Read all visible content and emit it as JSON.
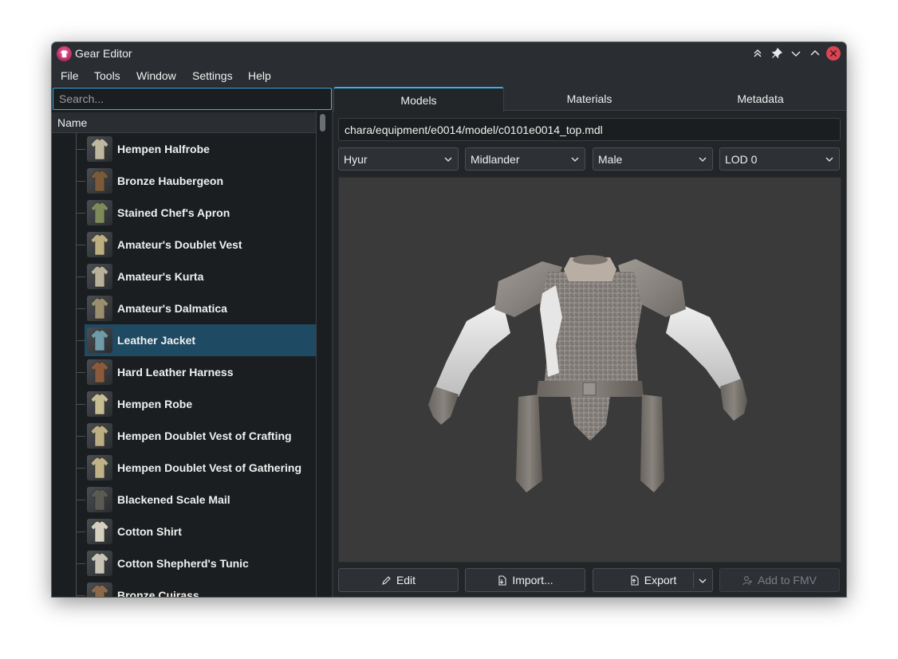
{
  "window": {
    "title": "Gear Editor"
  },
  "titlebar_buttons": [
    "keep-above-icon",
    "pin-icon",
    "minimize-icon",
    "maximize-icon",
    "close-icon"
  ],
  "menu": [
    "File",
    "Tools",
    "Window",
    "Settings",
    "Help"
  ],
  "sidebar": {
    "search_placeholder": "Search...",
    "header": "Name",
    "items": [
      {
        "label": "Hempen Halfrobe",
        "color": "#bfb7a0"
      },
      {
        "label": "Bronze Haubergeon",
        "color": "#7a5a3a"
      },
      {
        "label": "Stained Chef's Apron",
        "color": "#7e8a5a"
      },
      {
        "label": "Amateur's Doublet Vest",
        "color": "#bcae80"
      },
      {
        "label": "Amateur's Kurta",
        "color": "#b8b09a"
      },
      {
        "label": "Amateur's Dalmatica",
        "color": "#9a8e6e"
      },
      {
        "label": "Leather Jacket",
        "color": "#6f9aa8"
      },
      {
        "label": "Hard Leather Harness",
        "color": "#8a5a3a"
      },
      {
        "label": "Hempen Robe",
        "color": "#c8bd92"
      },
      {
        "label": "Hempen Doublet Vest of Crafting",
        "color": "#bcae80"
      },
      {
        "label": "Hempen Doublet Vest of Gathering",
        "color": "#c0b286"
      },
      {
        "label": "Blackened Scale Mail",
        "color": "#5a5a52"
      },
      {
        "label": "Cotton Shirt",
        "color": "#d6d0c0"
      },
      {
        "label": "Cotton Shepherd's Tunic",
        "color": "#c8c4b6"
      },
      {
        "label": "Bronze Cuirass",
        "color": "#8a6a4a"
      }
    ],
    "selected_index": 6
  },
  "tabs": [
    "Models",
    "Materials",
    "Metadata"
  ],
  "active_tab": "Models",
  "model_path": "chara/equipment/e0014/model/c0101e0014_top.mdl",
  "selectors": {
    "race": "Hyur",
    "tribe": "Midlander",
    "gender": "Male",
    "lod": "LOD 0"
  },
  "actions": {
    "edit": "Edit",
    "import": "Import...",
    "export": "Export",
    "add_fmv": "Add to FMV"
  },
  "colors": {
    "accent": "#3daee9",
    "selection": "#1f4a63",
    "close": "#da4453",
    "viewport_bg": "#3a3a3a"
  }
}
